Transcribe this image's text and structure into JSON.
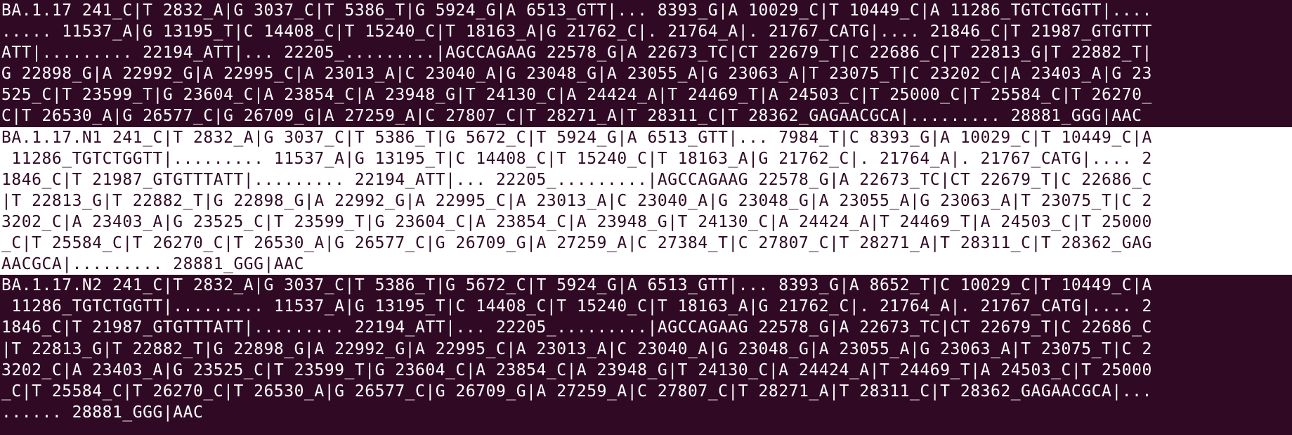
{
  "window": {
    "app": "Terminal",
    "colors": {
      "background": "#300a24",
      "foreground": "#ffffff",
      "selection_bg": "#ffffff",
      "selection_fg": "#300a24"
    }
  },
  "records": [
    {
      "lines": [
        "BA.1.17 241_C|T 2832_A|G 3037_C|T 5386_T|G 5924_G|A 6513_GTT|... 8393_G|A 10029_C|T 10449_C|A 11286_TGTCTGGTT|....",
        "..... 11537_A|G 13195_T|C 14408_C|T 15240_C|T 18163_A|G 21762_C|. 21764_A|. 21767_CATG|.... 21846_C|T 21987_GTGTTT",
        "ATT|......... 22194_ATT|... 22205_.........|AGCCAGAAG 22578_G|A 22673_TC|CT 22679_T|C 22686_C|T 22813_G|T 22882_T|",
        "G 22898_G|A 22992_G|A 22995_C|A 23013_A|C 23040_A|G 23048_G|A 23055_A|G 23063_A|T 23075_T|C 23202_C|A 23403_A|G 23",
        "525_C|T 23599_T|G 23604_C|A 23854_C|A 23948_G|T 24130_C|A 24424_A|T 24469_T|A 24503_C|T 25000_C|T 25584_C|T 26270_",
        "C|T 26530_A|G 26577_C|G 26709_G|A 27259_A|C 27807_C|T 28271_A|T 28311_C|T 28362_GAGAACGCA|......... 28881_GGG|AAC"
      ]
    },
    {
      "lines": [
        "BA.1.17.N1 241_C|T 2832_A|G 3037_C|T 5386_T|G 5672_C|T 5924_G|A 6513_GTT|... 7984_T|C 8393_G|A 10029_C|T 10449_C|A",
        " 11286_TGTCTGGTT|......... 11537_A|G 13195_T|C 14408_C|T 15240_C|T 18163_A|G 21762_C|. 21764_A|. 21767_CATG|.... 2",
        "1846_C|T 21987_GTGTTTATT|......... 22194_ATT|... 22205_.........|AGCCAGAAG 22578_G|A 22673_TC|CT 22679_T|C 22686_C",
        "|T 22813_G|T 22882_T|G 22898_G|A 22992_G|A 22995_C|A 23013_A|C 23040_A|G 23048_G|A 23055_A|G 23063_A|T 23075_T|C 2",
        "3202_C|A 23403_A|G 23525_C|T 23599_T|G 23604_C|A 23854_C|A 23948_G|T 24130_C|A 24424_A|T 24469_T|A 24503_C|T 25000",
        "_C|T 25584_C|T 26270_C|T 26530_A|G 26577_C|G 26709_G|A 27259_A|C 27384_T|C 27807_C|T 28271_A|T 28311_C|T 28362_GAG",
        "AACGCA|......... 28881_GGG|AAC"
      ]
    },
    {
      "lines": [
        "BA.1.17.N2 241_C|T 2832_A|G 3037_C|T 5386_T|G 5672_C|T 5924_G|A 6513_GTT|... 8393_G|A 8652_T|C 10029_C|T 10449_C|A",
        " 11286_TGTCTGGTT|......... 11537_A|G 13195_T|C 14408_C|T 15240_C|T 18163_A|G 21762_C|. 21764_A|. 21767_CATG|.... 2",
        "1846_C|T 21987_GTGTTTATT|......... 22194_ATT|... 22205_.........|AGCCAGAAG 22578_G|A 22673_TC|CT 22679_T|C 22686_C",
        "|T 22813_G|T 22882_T|G 22898_G|A 22992_G|A 22995_C|A 23013_A|C 23040_A|G 23048_G|A 23055_A|G 23063_A|T 23075_T|C 2",
        "3202_C|A 23403_A|G 23525_C|T 23599_T|G 23604_C|A 23854_C|A 23948_G|T 24130_C|A 24424_A|T 24469_T|A 24503_C|T 25000",
        "_C|T 25584_C|T 26270_C|T 26530_A|G 26577_C|G 26709_G|A 27259_A|C 27807_C|T 28271_A|T 28311_C|T 28362_GAGAACGCA|...",
        "...... 28881_GGG|AAC"
      ]
    },
    {
      "lines": [
        "                                                                                                                    "
      ]
    }
  ]
}
